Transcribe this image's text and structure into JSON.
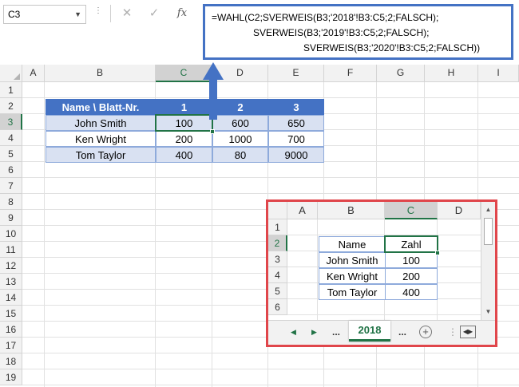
{
  "formula_bar": {
    "name_box": "C3",
    "cancel_glyph": "✕",
    "enter_glyph": "✓",
    "fx_glyph": "fx",
    "formula_lines": [
      "=WAHL(C2;SVERWEIS(B3;'2018'!B3:C5;2;FALSCH);",
      "SVERWEIS(B3;'2019'!B3:C5;2;FALSCH);",
      "SVERWEIS(B3;'2020'!B3:C5;2;FALSCH))"
    ],
    "accent_color": "#4472c4"
  },
  "sheet": {
    "columns": [
      "A",
      "B",
      "C",
      "D",
      "E",
      "F",
      "G",
      "H",
      "I"
    ],
    "selected_column": "C",
    "rows": [
      "1",
      "2",
      "3",
      "4",
      "5",
      "6",
      "7",
      "8",
      "9",
      "10",
      "11",
      "12",
      "13",
      "14",
      "15",
      "16",
      "17",
      "18",
      "19"
    ],
    "selected_row": "3",
    "active_cell": "C3",
    "table": {
      "header": [
        "Name \\ Blatt-Nr.",
        "1",
        "2",
        "3"
      ],
      "rows": [
        [
          "John Smith",
          "100",
          "600",
          "650"
        ],
        [
          "Ken Wright",
          "200",
          "1000",
          "700"
        ],
        [
          "Tom Taylor",
          "400",
          "80",
          "9000"
        ]
      ],
      "header_color": "#4472c4",
      "band_color": "#d9e1f2"
    }
  },
  "inset": {
    "border_color": "#e0464b",
    "columns": [
      "A",
      "B",
      "C",
      "D"
    ],
    "selected_column": "C",
    "rows": [
      "1",
      "2",
      "3",
      "4",
      "5",
      "6"
    ],
    "selected_row": "2",
    "table": {
      "header": [
        "Name",
        "Zahl"
      ],
      "rows": [
        [
          "John Smith",
          "100"
        ],
        [
          "Ken Wright",
          "200"
        ],
        [
          "Tom Taylor",
          "400"
        ]
      ]
    },
    "tabs": {
      "prev_glyph": "◀",
      "next_glyph": "▶",
      "ellipsis_left": "...",
      "active_tab": "2018",
      "ellipsis_right": "...",
      "add_glyph": "+",
      "options_glyph": "⋮"
    },
    "scroll_up_glyph": "▲",
    "scroll_down_glyph": "▼"
  }
}
